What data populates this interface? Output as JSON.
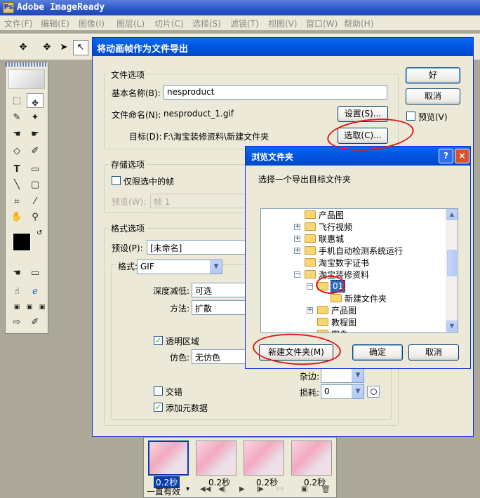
{
  "app": {
    "title": "Adobe ImageReady",
    "icon_label": "Ps"
  },
  "menu": [
    "文件(F)",
    "编辑(E)",
    "图像(I)",
    "图层(L)",
    "切片(C)",
    "选择(S)",
    "滤镜(T)",
    "视图(V)",
    "窗口(W)",
    "帮助(H)"
  ],
  "toolbar_icons": [
    "move-tool-icon",
    "slice-select-icon",
    "pointer-icon",
    "direct-select-icon"
  ],
  "export_dialog": {
    "title": "将动画帧作为文件导出",
    "file_options_label": "文件选项",
    "base_name_label": "基本名称(B):",
    "base_name_value": "nesproduct",
    "file_naming_label": "文件命名(N):",
    "file_naming_value": "nesproduct_1.gif",
    "settings_button": "设置(S)...",
    "target_label": "目标(D):",
    "target_value": "F:\\淘宝装修资料\\新建文件夹",
    "choose_button": "选取(C)...",
    "ok_button": "好",
    "cancel_button": "取消",
    "preview_label": "预览(V)",
    "storage_label": "存储选项",
    "only_selected_label": "仅限选中的帧",
    "preview_frame_label": "预览(W):",
    "preview_frame_value": "帧 1",
    "format_options_label": "格式选项",
    "preset_label": "预设(P):",
    "preset_value": "[未命名]",
    "format_label": "格式:",
    "format_value": "GIF",
    "depth_label": "深度减低:",
    "depth_value": "可选",
    "method_label": "方法:",
    "method_value": "扩散",
    "transparency_label": "透明区域",
    "dither_label": "仿色:",
    "dither_value": "无仿色",
    "matte_label": "杂边:",
    "interlace_label": "交错",
    "lossy_label": "损耗:",
    "lossy_value": "0",
    "metadata_label": "添加元数据"
  },
  "browse_dialog": {
    "title": "浏览文件夹",
    "help_button": "?",
    "close_button": "×",
    "prompt": "选择一个导出目标文件夹",
    "tree": [
      {
        "label": "产品图",
        "indent": 0,
        "expander": ""
      },
      {
        "label": "飞行视频",
        "indent": 0,
        "expander": "+"
      },
      {
        "label": "联惠城",
        "indent": 0,
        "expander": "+"
      },
      {
        "label": "手机自动检测系统运行",
        "indent": 0,
        "expander": "+"
      },
      {
        "label": "淘宝数字证书",
        "indent": 0,
        "expander": ""
      },
      {
        "label": "淘宝装修资料",
        "indent": 0,
        "expander": "−"
      },
      {
        "label": "01",
        "indent": 1,
        "expander": "−",
        "selected": true
      },
      {
        "label": "新建文件夹",
        "indent": 2,
        "expander": ""
      },
      {
        "label": "产品图",
        "indent": 1,
        "expander": "+"
      },
      {
        "label": "教程图",
        "indent": 1,
        "expander": ""
      },
      {
        "label": "案件",
        "indent": 1,
        "expander": ""
      }
    ],
    "new_folder_button": "新建文件夹(M)",
    "ok_button": "确定",
    "cancel_button": "取消"
  },
  "animation": {
    "frames": [
      {
        "delay": "0.2秒"
      },
      {
        "delay": "0.2秒"
      },
      {
        "delay": "0.2秒"
      },
      {
        "delay": "0.2秒"
      }
    ],
    "loop_label": "一直有效"
  },
  "annotation_color": "#e01818"
}
